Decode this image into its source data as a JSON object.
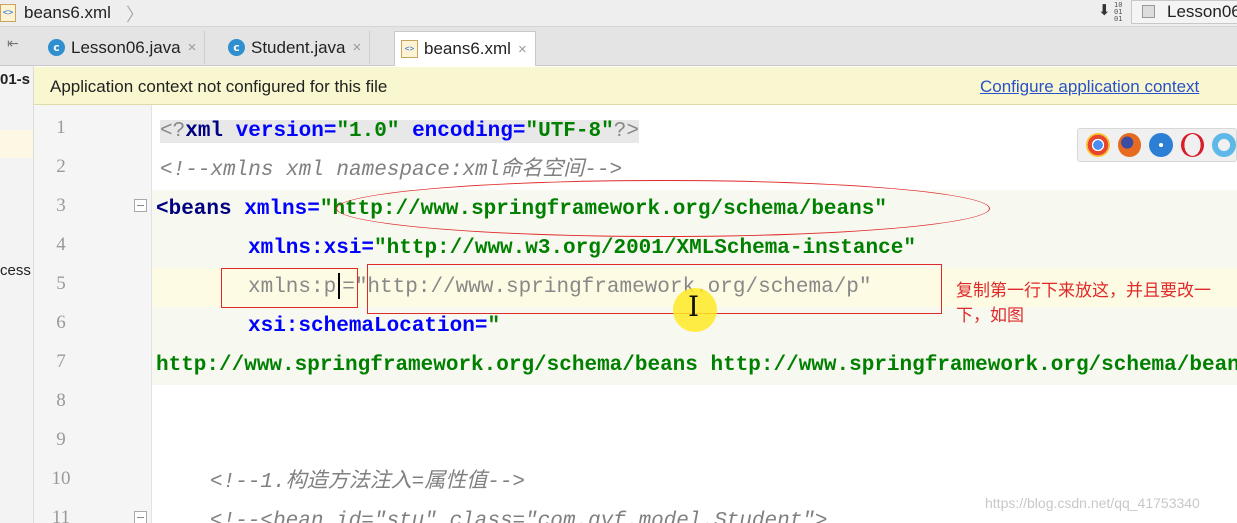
{
  "breadcrumb": {
    "file": "beans6.xml",
    "file_icon": "xml-file-icon"
  },
  "toolbar": {
    "run_config": "Lesson06"
  },
  "tabs": [
    {
      "label": "Lesson06.java",
      "badge": "c",
      "active": false
    },
    {
      "label": "Student.java",
      "badge": "c",
      "active": false
    },
    {
      "label": "beans6.xml",
      "badge": "xml",
      "active": true
    }
  ],
  "project_panel": {
    "fragment_top": "01-s",
    "fragment_mid": "cess"
  },
  "banner": {
    "message": "Application context not configured for this file",
    "link": "Configure application context"
  },
  "editor": {
    "lines": [
      {
        "num": "1"
      },
      {
        "num": "2"
      },
      {
        "num": "3"
      },
      {
        "num": "4"
      },
      {
        "num": "5"
      },
      {
        "num": "6"
      },
      {
        "num": "7"
      },
      {
        "num": "8"
      },
      {
        "num": "9"
      },
      {
        "num": "10"
      },
      {
        "num": "11"
      }
    ],
    "code": {
      "l1_open": "<?",
      "l1_tag": "xml",
      "l1_attr1": " version=",
      "l1_val1": "\"1.0\"",
      "l1_attr2": " encoding=",
      "l1_val2": "\"UTF-8\"",
      "l1_close": "?>",
      "l2": "<!--xmlns xml namespace:xml命名空间-->",
      "l3_tag": "<beans",
      "l3_attr": " xmlns=",
      "l3_val": "\"http://www.springframework.org/schema/beans\"",
      "l4_attr": "xmlns:xsi=",
      "l4_val": "\"http://www.w3.org/2001/XMLSchema-instance\"",
      "l5_attr": "xmlns:p",
      "l5_eq": "=",
      "l5_val": "\"http://www.springframework.org/schema/p\"",
      "l6_attr": "xsi:schemaLocation=",
      "l6_val": "\"",
      "l7_val": "http://www.springframework.org/schema/beans http://www.springframework.org/schema/beans",
      "l10": "<!--1.构造方法注入=属性值-->",
      "l11": "<!--<bean id=\"stu\" class=\"com.gyf.model.Student\">"
    }
  },
  "annotation": {
    "note": "复制第一行下来放这，并且要改一下，如图"
  },
  "browsers": [
    {
      "icon": "chrome-icon",
      "color": "#e8452c"
    },
    {
      "icon": "firefox-icon",
      "color": "#e66a1f"
    },
    {
      "icon": "safari-icon",
      "color": "#2d7fd6"
    },
    {
      "icon": "opera-icon",
      "color": "#d81e28"
    },
    {
      "icon": "ie-icon",
      "color": "#5fb8e8"
    }
  ],
  "watermark": "https://blog.csdn.net/qq_41753340"
}
